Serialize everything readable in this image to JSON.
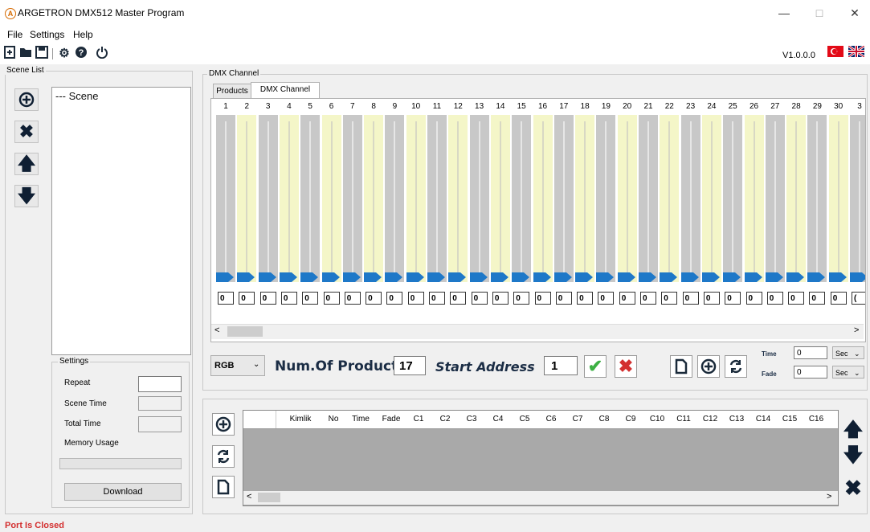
{
  "window": {
    "title": "ARGETRON DMX512 Master Program",
    "app_icon": "A",
    "minimize": "—",
    "maximize": "□",
    "close": "✕"
  },
  "menu": [
    "File",
    "Settings",
    "Help"
  ],
  "toolbar": {
    "version": "V1.0.0.0"
  },
  "scene_list": {
    "label": "Scene List",
    "tree_item": "--- Scene",
    "settings_label": "Settings",
    "repeat": "Repeat",
    "scene_time": "Scene Time",
    "total_time": "Total Time",
    "memory_usage": "Memory Usage",
    "download": "Download"
  },
  "dmx": {
    "group_label": "DMX Channel",
    "tabs": [
      "Products",
      "DMX Channel"
    ],
    "channels": [
      "1",
      "2",
      "3",
      "4",
      "5",
      "6",
      "7",
      "8",
      "9",
      "10",
      "11",
      "12",
      "13",
      "14",
      "15",
      "16",
      "17",
      "18",
      "19",
      "20",
      "21",
      "22",
      "23",
      "24",
      "25",
      "26",
      "27",
      "28",
      "29",
      "30",
      "3"
    ],
    "values": [
      "0",
      "0",
      "0",
      "0",
      "0",
      "0",
      "0",
      "0",
      "0",
      "0",
      "0",
      "0",
      "0",
      "0",
      "0",
      "0",
      "0",
      "0",
      "0",
      "0",
      "0",
      "0",
      "0",
      "0",
      "0",
      "0",
      "0",
      "0",
      "0",
      "0",
      "("
    ],
    "scroll_left": "<",
    "scroll_right": ">"
  },
  "controls": {
    "mode": "RGB",
    "num_products_label": "Num.Of Products",
    "num_products": "17",
    "start_address_label": "Start Address",
    "start_address": "1",
    "time_label": "Time",
    "time_value": "0",
    "time_unit": "Sec",
    "fade_label": "Fade",
    "fade_value": "0",
    "fade_unit": "Sec"
  },
  "grid": {
    "columns": [
      "Kimlik",
      "No",
      "Time",
      "Fade",
      "C1",
      "C2",
      "C3",
      "C4",
      "C5",
      "C6",
      "C7",
      "C8",
      "C9",
      "C10",
      "C11",
      "C12",
      "C13",
      "C14",
      "C15",
      "C16"
    ],
    "scroll_left": "<",
    "scroll_right": ">"
  },
  "status": {
    "text": "Port Is Closed",
    "color": "#d32f2f"
  },
  "colors": {
    "accent_blue": "#1e78c8",
    "slider_light": "#f4f6c8",
    "slider_dark": "#c8c8c8",
    "check_green": "#3cb043",
    "cross_red": "#d32f2f"
  }
}
